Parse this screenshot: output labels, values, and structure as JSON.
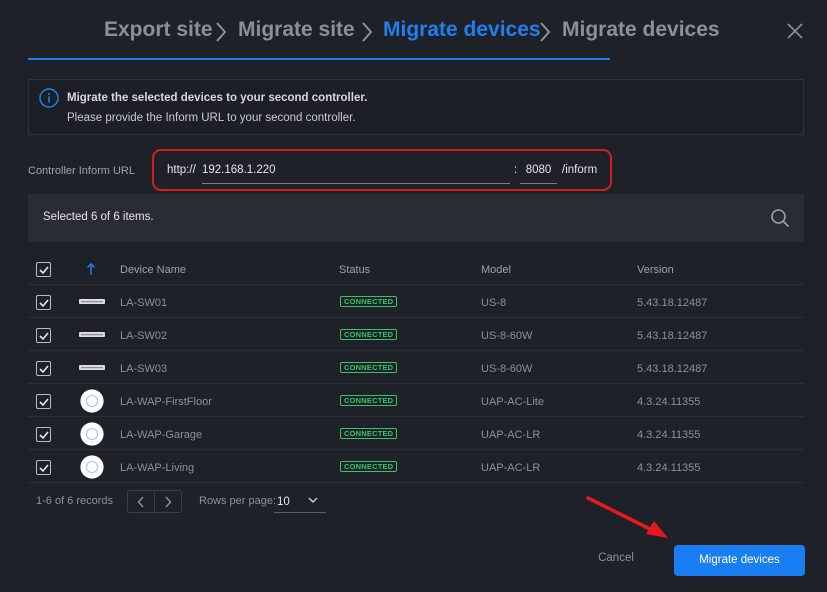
{
  "stepper": {
    "steps": [
      {
        "label": "Export site"
      },
      {
        "label": "Migrate site"
      },
      {
        "label": "Migrate devices"
      },
      {
        "label": "Migrate devices"
      }
    ]
  },
  "info": {
    "line1": "Migrate the selected devices to your second controller.",
    "line2": "Please provide the Inform URL to your second controller."
  },
  "inform_url": {
    "label": "Controller Inform URL",
    "prefix": "http://",
    "host": "192.168.1.220",
    "colon": ":",
    "port": "8080",
    "suffix": "/inform"
  },
  "selection": {
    "text": "Selected 6 of 6 items."
  },
  "table": {
    "columns": [
      "Device Name",
      "Status",
      "Model",
      "Version"
    ],
    "rows": [
      {
        "name": "LA-SW01",
        "status": "CONNECTED",
        "model": "US-8",
        "version": "5.43.18.12487",
        "icon": "switch"
      },
      {
        "name": "LA-SW02",
        "status": "CONNECTED",
        "model": "US-8-60W",
        "version": "5.43.18.12487",
        "icon": "switch"
      },
      {
        "name": "LA-SW03",
        "status": "CONNECTED",
        "model": "US-8-60W",
        "version": "5.43.18.12487",
        "icon": "switch"
      },
      {
        "name": "LA-WAP-FirstFloor",
        "status": "CONNECTED",
        "model": "UAP-AC-Lite",
        "version": "4.3.24.11355",
        "icon": "ap"
      },
      {
        "name": "LA-WAP-Garage",
        "status": "CONNECTED",
        "model": "UAP-AC-LR",
        "version": "4.3.24.11355",
        "icon": "ap"
      },
      {
        "name": "LA-WAP-Living",
        "status": "CONNECTED",
        "model": "UAP-AC-LR",
        "version": "4.3.24.11355",
        "icon": "ap"
      }
    ]
  },
  "footer": {
    "records": "1-6 of 6 records",
    "rows_per_page_label": "Rows per page:",
    "rows_per_page_value": "10",
    "cancel": "Cancel",
    "migrate": "Migrate devices"
  },
  "colors": {
    "accent": "#1f7ef0",
    "connected": "#35c46a",
    "highlight": "#d11f24",
    "background": "#1f2129"
  }
}
